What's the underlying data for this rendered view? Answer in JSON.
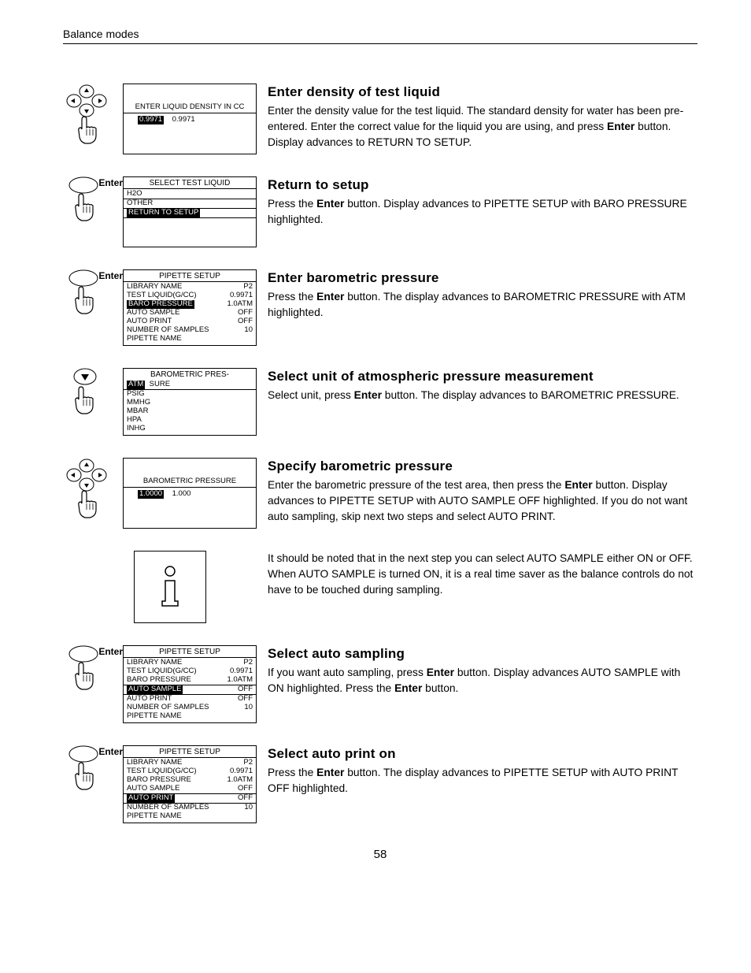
{
  "header": {
    "title": "Balance modes"
  },
  "page_number": "58",
  "enter_label": "Enter",
  "steps": [
    {
      "icon": "dpad",
      "display_kind": "density",
      "display": {
        "line1": "ENTER LIQUID DENSITY IN CC",
        "hl": "0.9971",
        "val": "0.9971"
      },
      "title": "Enter density of test liquid",
      "body": "Enter the density value for the test liquid.  The standard density for water has been pre-entered.  Enter the correct value for the liquid you are using, and press <b>Enter</b> button.  Display advances to RETURN TO SETUP."
    },
    {
      "icon": "enter",
      "display_kind": "testliquid",
      "display": {
        "title": "SELECT TEST LIQUID",
        "rows": [
          "H2O",
          "OTHER",
          "RETURN TO SETUP"
        ],
        "hl_index": 2
      },
      "title": "Return to setup",
      "body": "Press the <b>Enter</b> button.  Display advances to PIPETTE SETUP with BARO PRESSURE highlighted."
    },
    {
      "icon": "enter",
      "display_kind": "setup",
      "display": {
        "title": "PIPETTE SETUP",
        "rows": [
          {
            "l": "LIBRARY NAME",
            "r": "P2"
          },
          {
            "l": "TEST LIQUID(G/CC)",
            "r": "0.9971"
          },
          {
            "l": "BARO PRESSURE",
            "r": "1.0ATM",
            "hl": "l"
          },
          {
            "l": "AUTO SAMPLE",
            "r": "OFF"
          },
          {
            "l": "AUTO PRINT",
            "r": "OFF"
          },
          {
            "l": "NUMBER OF SAMPLES",
            "r": "10"
          },
          {
            "l": "PIPETTE NAME",
            "r": ""
          }
        ]
      },
      "title": "Enter barometric pressure",
      "body": "Press the <b>Enter</b> button.  The display advances to BAROMETRIC PRESSURE with ATM highlighted."
    },
    {
      "icon": "down",
      "display_kind": "units",
      "display": {
        "title": "BAROMETRIC PRES-",
        "sure": "SURE",
        "rows": [
          "ATM",
          "PSIG",
          "MMHG",
          "MBAR",
          "HPA",
          "INHG"
        ],
        "hl_index": 0
      },
      "title": "Select unit of atmospheric pressure measurement",
      "body": "Select unit, press <b>Enter</b> button.  The display advances to BAROMETRIC PRESSURE."
    },
    {
      "icon": "dpad",
      "display_kind": "baro",
      "display": {
        "line1": "BAROMETRIC PRESSURE",
        "hl": "1.0000",
        "val": "1.000"
      },
      "title": "Specify barometric pressure",
      "body": "Enter the barometric pressure of the test area, then press the <b>Enter</b> button.  Display advances to PIPETTE SETUP with AUTO SAMPLE OFF highlighted.   If you do not want auto sampling, skip next two steps and select AUTO PRINT."
    },
    {
      "icon": "info",
      "display_kind": "none",
      "title": "",
      "body": "It should be noted that in the next step you can select AUTO SAMPLE either ON or OFF.  When AUTO SAMPLE is turned ON, it is a real time saver as the balance controls do not have to be touched during sampling."
    },
    {
      "icon": "enter",
      "display_kind": "setup",
      "display": {
        "title": "PIPETTE SETUP",
        "rows": [
          {
            "l": "LIBRARY NAME",
            "r": "P2"
          },
          {
            "l": "TEST LIQUID(G/CC)",
            "r": "0.9971"
          },
          {
            "l": "BARO PRESSURE",
            "r": "1.0ATM"
          },
          {
            "l": "AUTO SAMPLE",
            "r": "OFF",
            "hl": "l"
          },
          {
            "l": "AUTO PRINT",
            "r": "OFF",
            "hl_row": true
          },
          {
            "l": "NUMBER OF SAMPLES",
            "r": "10"
          },
          {
            "l": "PIPETTE NAME",
            "r": ""
          }
        ],
        "hl_rule_after": 3
      },
      "title": "Select auto sampling",
      "body": "If you want auto sampling, press <b>Enter</b> button.  Display advances AUTO SAMPLE with ON highlighted.  Press the <b>Enter</b> button."
    },
    {
      "icon": "enter",
      "display_kind": "setup",
      "display": {
        "title": "PIPETTE SETUP",
        "rows": [
          {
            "l": "LIBRARY NAME",
            "r": "P2"
          },
          {
            "l": "TEST LIQUID(G/CC)",
            "r": "0.9971"
          },
          {
            "l": "BARO PRESSURE",
            "r": "1.0ATM"
          },
          {
            "l": "AUTO SAMPLE",
            "r": "OFF"
          },
          {
            "l": "AUTO PRINT",
            "r": "OFF",
            "hl": "l"
          },
          {
            "l": "NUMBER OF SAMPLES",
            "r": "10",
            "hl_row": true
          },
          {
            "l": "PIPETTE NAME",
            "r": ""
          }
        ],
        "hl_rule_after": 4
      },
      "title": "Select auto print on",
      "body": "Press the <b>Enter</b> button. The display advances to PIPETTE SETUP with AUTO PRINT  OFF highlighted."
    }
  ]
}
